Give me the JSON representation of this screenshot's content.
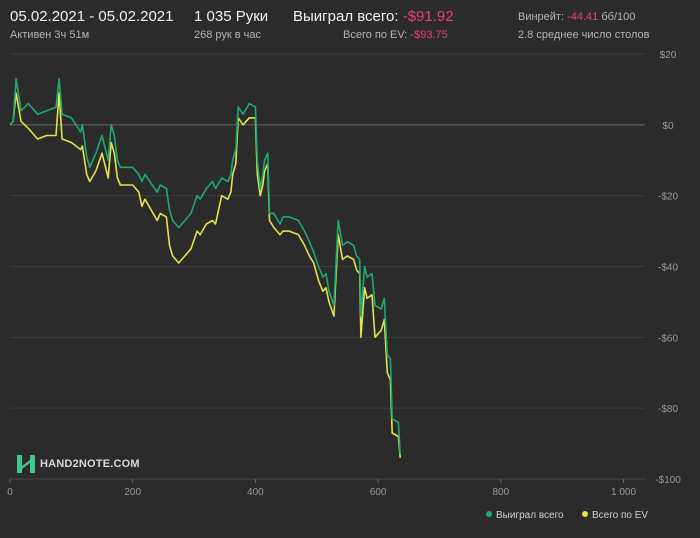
{
  "header": {
    "date_range": "05.02.2021 - 05.02.2021",
    "active": "Активен 3ч 51м",
    "hands": "1 035 Руки",
    "hands_per_hour": "268 рук в час",
    "won_label": "Выиграл всего:",
    "won_value": "-$91.92",
    "ev_label": "Всего по EV:",
    "ev_value": "-$93.75",
    "winrate_label": "Винрейт:",
    "winrate_value": "-44.41",
    "winrate_unit": "бб/100",
    "tables": "2.8 среднее число столов"
  },
  "logo": {
    "text": "HAND2NOTE.COM"
  },
  "colors": {
    "won": "#1fa971",
    "ev": "#e4e24a",
    "negative": "#ea3f78",
    "background": "#2b2b2b"
  },
  "chart_data": {
    "type": "line",
    "xlim": [
      0,
      1035
    ],
    "ylim": [
      -100,
      20
    ],
    "x_ticks": [
      0,
      200,
      400,
      600,
      800,
      1000
    ],
    "x_tick_labels": [
      "0",
      "200",
      "400",
      "600",
      "800",
      "1 000"
    ],
    "y_ticks": [
      20,
      0,
      -20,
      -40,
      -60,
      -80,
      -100
    ],
    "y_tick_labels": [
      "$20",
      "$0",
      "-$20",
      "-$40",
      "-$60",
      "-$80",
      "-$100"
    ],
    "legend_position": "bottom-right",
    "grid": true,
    "series": [
      {
        "name": "Выиграл всего",
        "color": "#1fa971",
        "points": [
          [
            0,
            0
          ],
          [
            5,
            1
          ],
          [
            10,
            13
          ],
          [
            18,
            4
          ],
          [
            30,
            6
          ],
          [
            45,
            3
          ],
          [
            60,
            4
          ],
          [
            75,
            5
          ],
          [
            80,
            13
          ],
          [
            85,
            3
          ],
          [
            100,
            2
          ],
          [
            115,
            -2
          ],
          [
            118,
            0
          ],
          [
            125,
            -9
          ],
          [
            130,
            -12
          ],
          [
            140,
            -8
          ],
          [
            150,
            -3
          ],
          [
            160,
            -10
          ],
          [
            165,
            0
          ],
          [
            170,
            -3
          ],
          [
            175,
            -10
          ],
          [
            180,
            -12
          ],
          [
            200,
            -12
          ],
          [
            210,
            -14
          ],
          [
            215,
            -16
          ],
          [
            220,
            -14
          ],
          [
            240,
            -19
          ],
          [
            245,
            -17
          ],
          [
            255,
            -18
          ],
          [
            260,
            -24
          ],
          [
            265,
            -27
          ],
          [
            275,
            -29
          ],
          [
            285,
            -27
          ],
          [
            295,
            -25
          ],
          [
            305,
            -20
          ],
          [
            310,
            -21
          ],
          [
            320,
            -18
          ],
          [
            330,
            -16
          ],
          [
            335,
            -18
          ],
          [
            345,
            -15
          ],
          [
            355,
            -16
          ],
          [
            360,
            -14
          ],
          [
            363,
            -10
          ],
          [
            368,
            -7
          ],
          [
            372,
            5
          ],
          [
            380,
            3
          ],
          [
            390,
            6
          ],
          [
            400,
            5
          ],
          [
            403,
            -10
          ],
          [
            408,
            -18
          ],
          [
            412,
            -14
          ],
          [
            415,
            -10
          ],
          [
            420,
            -8
          ],
          [
            423,
            -25
          ],
          [
            430,
            -25
          ],
          [
            440,
            -28
          ],
          [
            445,
            -26
          ],
          [
            455,
            -26
          ],
          [
            470,
            -27
          ],
          [
            480,
            -30
          ],
          [
            488,
            -33
          ],
          [
            495,
            -36
          ],
          [
            503,
            -40
          ],
          [
            510,
            -43
          ],
          [
            515,
            -42
          ],
          [
            520,
            -47
          ],
          [
            528,
            -51
          ],
          [
            535,
            -27
          ],
          [
            542,
            -34
          ],
          [
            550,
            -33
          ],
          [
            560,
            -34
          ],
          [
            565,
            -37
          ],
          [
            570,
            -38
          ],
          [
            572,
            -54
          ],
          [
            578,
            -40
          ],
          [
            582,
            -43
          ],
          [
            590,
            -42
          ],
          [
            595,
            -51
          ],
          [
            605,
            -52
          ],
          [
            610,
            -49
          ],
          [
            615,
            -65
          ],
          [
            620,
            -66
          ],
          [
            623,
            -83
          ],
          [
            633,
            -84
          ],
          [
            636,
            -93
          ]
        ]
      },
      {
        "name": "Всего по EV",
        "color": "#e4e24a",
        "points": [
          [
            0,
            0
          ],
          [
            5,
            1
          ],
          [
            10,
            9
          ],
          [
            18,
            1
          ],
          [
            30,
            -1
          ],
          [
            45,
            -4
          ],
          [
            60,
            -3
          ],
          [
            75,
            -3
          ],
          [
            80,
            9
          ],
          [
            85,
            -4
          ],
          [
            100,
            -5
          ],
          [
            115,
            -7
          ],
          [
            118,
            -6
          ],
          [
            125,
            -14
          ],
          [
            130,
            -16
          ],
          [
            140,
            -13
          ],
          [
            150,
            -8
          ],
          [
            160,
            -15
          ],
          [
            165,
            -5
          ],
          [
            170,
            -8
          ],
          [
            175,
            -15
          ],
          [
            180,
            -17
          ],
          [
            200,
            -17
          ],
          [
            210,
            -19
          ],
          [
            215,
            -23
          ],
          [
            220,
            -21
          ],
          [
            240,
            -27
          ],
          [
            245,
            -25
          ],
          [
            255,
            -26
          ],
          [
            260,
            -34
          ],
          [
            265,
            -37
          ],
          [
            275,
            -39
          ],
          [
            285,
            -37
          ],
          [
            295,
            -35
          ],
          [
            305,
            -30
          ],
          [
            310,
            -31
          ],
          [
            320,
            -28
          ],
          [
            330,
            -27
          ],
          [
            335,
            -28
          ],
          [
            345,
            -20
          ],
          [
            355,
            -21
          ],
          [
            360,
            -19
          ],
          [
            363,
            -14
          ],
          [
            368,
            -11
          ],
          [
            372,
            2
          ],
          [
            380,
            0
          ],
          [
            390,
            2
          ],
          [
            400,
            2
          ],
          [
            403,
            -14
          ],
          [
            408,
            -20
          ],
          [
            412,
            -17
          ],
          [
            415,
            -13
          ],
          [
            420,
            -11
          ],
          [
            423,
            -27
          ],
          [
            430,
            -29
          ],
          [
            440,
            -31
          ],
          [
            445,
            -30
          ],
          [
            455,
            -30
          ],
          [
            470,
            -31
          ],
          [
            480,
            -34
          ],
          [
            488,
            -37
          ],
          [
            495,
            -39
          ],
          [
            503,
            -44
          ],
          [
            510,
            -47
          ],
          [
            515,
            -46
          ],
          [
            520,
            -50
          ],
          [
            528,
            -54
          ],
          [
            535,
            -31
          ],
          [
            542,
            -38
          ],
          [
            550,
            -37
          ],
          [
            560,
            -38
          ],
          [
            565,
            -41
          ],
          [
            570,
            -42
          ],
          [
            572,
            -60
          ],
          [
            578,
            -46
          ],
          [
            582,
            -49
          ],
          [
            590,
            -48
          ],
          [
            595,
            -60
          ],
          [
            605,
            -58
          ],
          [
            610,
            -55
          ],
          [
            615,
            -70
          ],
          [
            620,
            -72
          ],
          [
            623,
            -87
          ],
          [
            633,
            -88
          ],
          [
            636,
            -94
          ]
        ]
      }
    ]
  }
}
